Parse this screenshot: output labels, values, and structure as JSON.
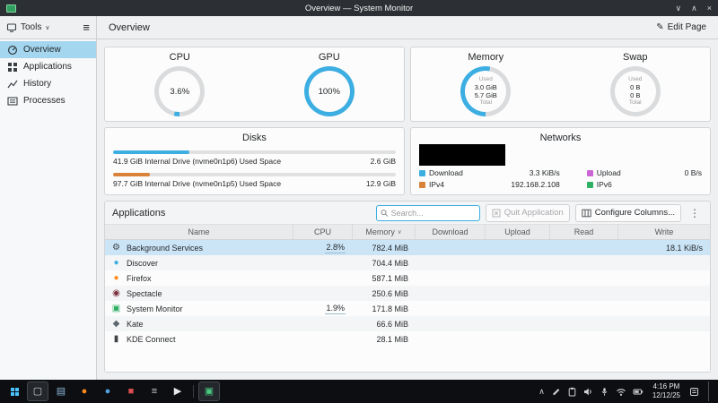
{
  "titlebar": {
    "title": "Overview — System Monitor",
    "minimize_glyph": "∨",
    "maximize_glyph": "∧",
    "close_glyph": "×"
  },
  "header": {
    "tools_label": "Tools",
    "tools_chevron": "∨",
    "menu_glyph": "≡",
    "page_title": "Overview",
    "edit_page_glyph": "✎",
    "edit_page_label": "Edit Page"
  },
  "sidebar": {
    "items": [
      {
        "label": "Overview"
      },
      {
        "label": "Applications"
      },
      {
        "label": "History"
      },
      {
        "label": "Processes"
      }
    ]
  },
  "sensors": {
    "gauges": [
      {
        "title": "CPU",
        "center_value": "3.6%",
        "percent": 3.6
      },
      {
        "title": "GPU",
        "center_value": "100%",
        "percent": 100
      },
      {
        "title": "Memory",
        "used_label": "Used",
        "used_value": "3.0 GiB",
        "total_value": "5.7 GiB",
        "total_label": "Total",
        "percent": 53
      },
      {
        "title": "Swap",
        "used_label": "Used",
        "used_value": "0 B",
        "total_value": "0 B",
        "total_label": "Total",
        "percent": 0
      }
    ]
  },
  "disks": {
    "title": "Disks",
    "items": [
      {
        "label": "41.9 GiB Internal Drive (nvme0n1p6) Used Space",
        "value": "2.6 GiB",
        "bar_width": "27%",
        "bar_color": "#3daee2"
      },
      {
        "label": "97.7 GiB Internal Drive (nvme0n1p5) Used Space",
        "value": "12.9 GiB",
        "bar_width": "13%",
        "bar_color": "#d9823a"
      }
    ]
  },
  "networks": {
    "title": "Networks",
    "legend": [
      {
        "label": "Download",
        "value": "3.3 KiB/s",
        "color": "#3daee2"
      },
      {
        "label": "Upload",
        "value": "0 B/s",
        "color": "#cb66d6"
      },
      {
        "label": "IPv4",
        "value": "192.168.2.108",
        "color": "#d9823a"
      },
      {
        "label": "IPv6",
        "value": "",
        "color": "#2fb065"
      }
    ]
  },
  "applications": {
    "section_title": "Applications",
    "search_placeholder": "Search...",
    "quit_button_label": "Quit Application",
    "configure_button_label": "Configure Columns...",
    "overflow_glyph": "⋮",
    "columns": [
      "Name",
      "CPU",
      "Memory",
      "Download",
      "Upload",
      "Read",
      "Write"
    ],
    "sort_glyph": "∨",
    "rows": [
      {
        "name": "Background Services",
        "icon_glyph": "⚙",
        "icon_color": "#43474a",
        "cpu": "2.8%",
        "memory": "782.4 MiB",
        "download": "",
        "upload": "",
        "read": "",
        "write": "18.1 KiB/s"
      },
      {
        "name": "Discover",
        "icon_glyph": "●",
        "icon_color": "#3daee2",
        "cpu": "",
        "memory": "704.4 MiB",
        "download": "",
        "upload": "",
        "read": "",
        "write": ""
      },
      {
        "name": "Firefox",
        "icon_glyph": "●",
        "icon_color": "#ff8a1d",
        "cpu": "",
        "memory": "587.1 MiB",
        "download": "",
        "upload": "",
        "read": "",
        "write": ""
      },
      {
        "name": "Spectacle",
        "icon_glyph": "◉",
        "icon_color": "#7a2d3c",
        "cpu": "",
        "memory": "250.6 MiB",
        "download": "",
        "upload": "",
        "read": "",
        "write": ""
      },
      {
        "name": "System Monitor",
        "icon_glyph": "▣",
        "icon_color": "#2faf64",
        "cpu": "1.9%",
        "memory": "171.8 MiB",
        "download": "",
        "upload": "",
        "read": "",
        "write": ""
      },
      {
        "name": "Kate",
        "icon_glyph": "◆",
        "icon_color": "#5c6770",
        "cpu": "",
        "memory": "66.6 MiB",
        "download": "",
        "upload": "",
        "read": "",
        "write": ""
      },
      {
        "name": "KDE Connect",
        "icon_glyph": "▮",
        "icon_color": "#3f4346",
        "cpu": "",
        "memory": "28.1 MiB",
        "download": "",
        "upload": "",
        "read": "",
        "write": ""
      }
    ]
  },
  "taskbar": {
    "apps": [
      {
        "name": "task-view",
        "glyph": "▢",
        "color": "#cfd2d5"
      },
      {
        "name": "file-manager",
        "glyph": "▤",
        "color": "#8ab4d8"
      },
      {
        "name": "firefox",
        "glyph": "●",
        "color": "#ff8a1d"
      },
      {
        "name": "browser",
        "glyph": "●",
        "color": "#4ea3e0"
      },
      {
        "name": "ide",
        "glyph": "■",
        "color": "#d94f4f"
      },
      {
        "name": "notes",
        "glyph": "≡",
        "color": "#c8cbce"
      },
      {
        "name": "media-player",
        "glyph": "▶",
        "color": "#e8e9eb"
      },
      {
        "name": "system-monitor",
        "glyph": "▣",
        "color": "#49c77f"
      }
    ],
    "tray_expand_glyph": "∧",
    "clock_time": "4:16 PM",
    "clock_date": "12/12/25"
  },
  "colors": {
    "accent": "#3daee2",
    "gauge_track": "#dadbdd"
  }
}
